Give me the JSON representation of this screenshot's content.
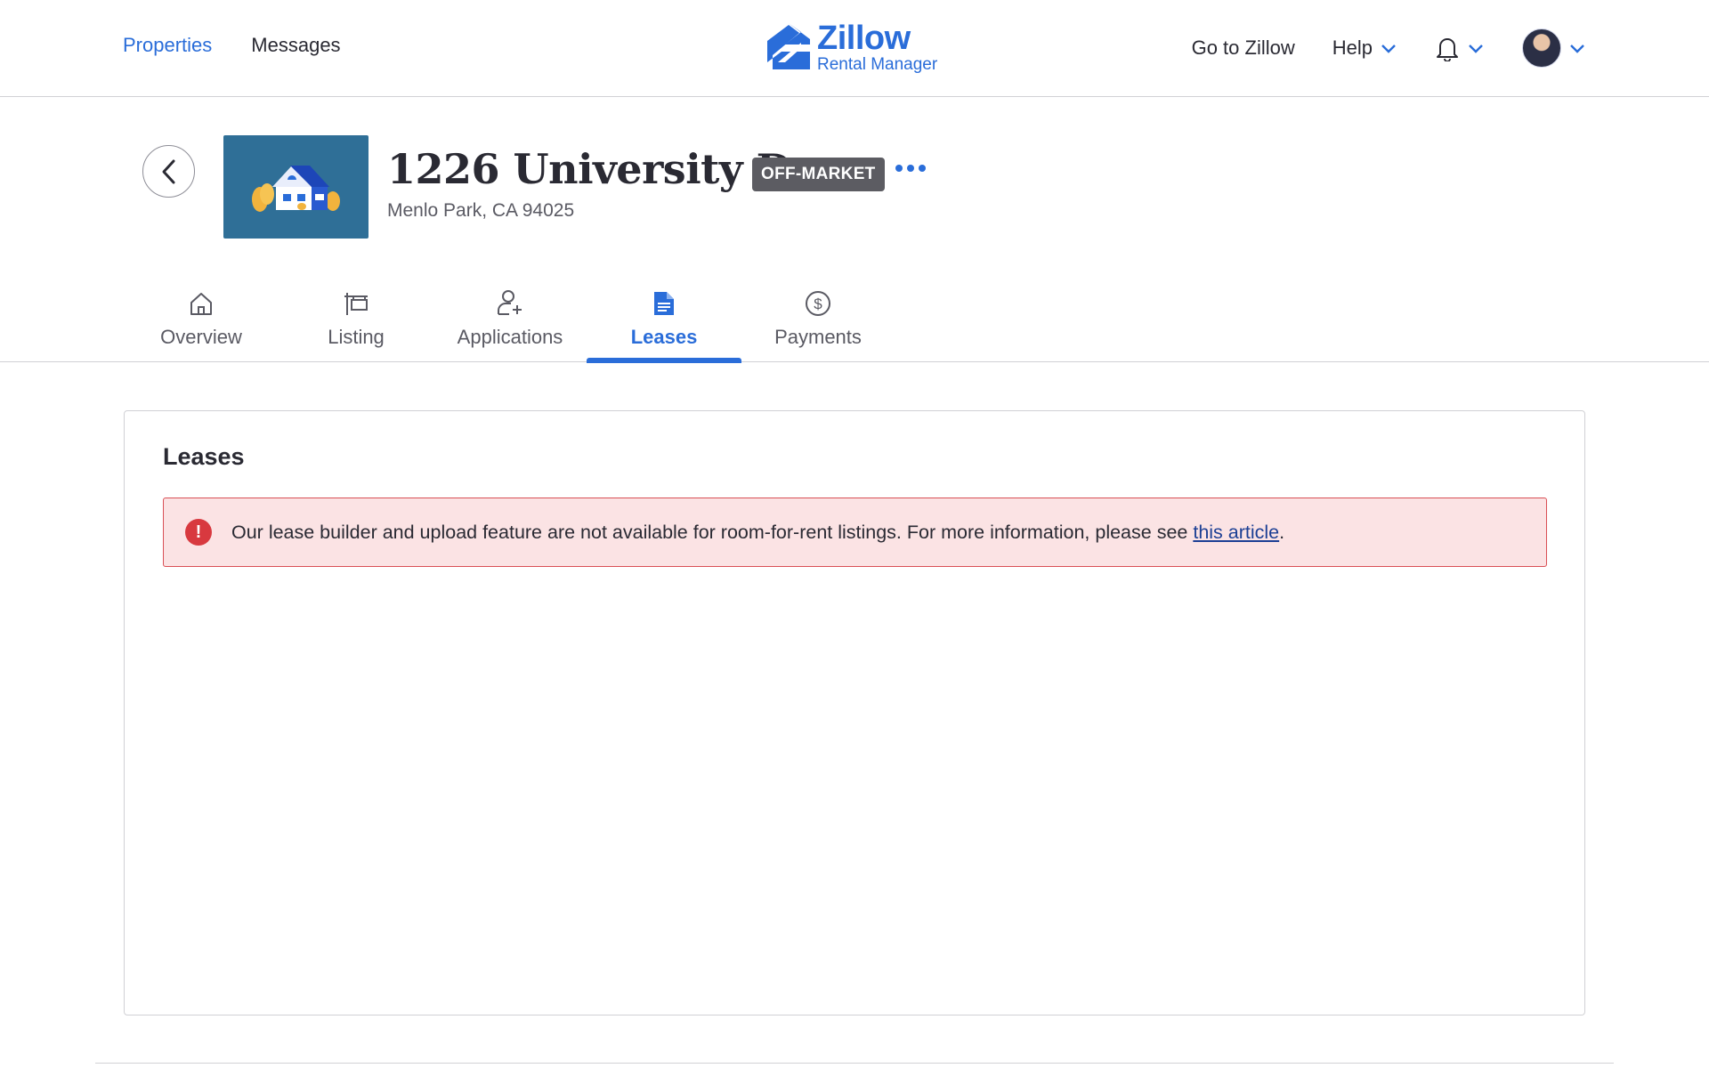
{
  "header": {
    "nav": [
      {
        "label": "Properties",
        "active": true
      },
      {
        "label": "Messages",
        "active": false
      }
    ],
    "logo": {
      "brand": "Zillow",
      "product": "Rental Manager"
    },
    "right": {
      "go_to": "Go to Zillow",
      "help": "Help"
    },
    "icons": [
      "bell-icon",
      "chevron-down-icon",
      "avatar"
    ],
    "accent_color": "#2a6dd9"
  },
  "property": {
    "title": "1226 University Dr",
    "status_badge": "OFF-MARKET",
    "address": "Menlo Park, CA 94025"
  },
  "tabs": [
    {
      "label": "Overview",
      "icon": "home-icon",
      "active": false
    },
    {
      "label": "Listing",
      "icon": "sign-icon",
      "active": false
    },
    {
      "label": "Applications",
      "icon": "add-user-icon",
      "active": false
    },
    {
      "label": "Leases",
      "icon": "document-icon",
      "active": true
    },
    {
      "label": "Payments",
      "icon": "dollar-icon",
      "active": false
    }
  ],
  "leases": {
    "title": "Leases",
    "alert": {
      "text": "Our lease builder and upload feature are not available for room-for-rent listings. For more information, please see ",
      "link_text": "this article",
      "suffix": ".",
      "icon": "exclamation-icon",
      "color": "#d94f55"
    }
  }
}
